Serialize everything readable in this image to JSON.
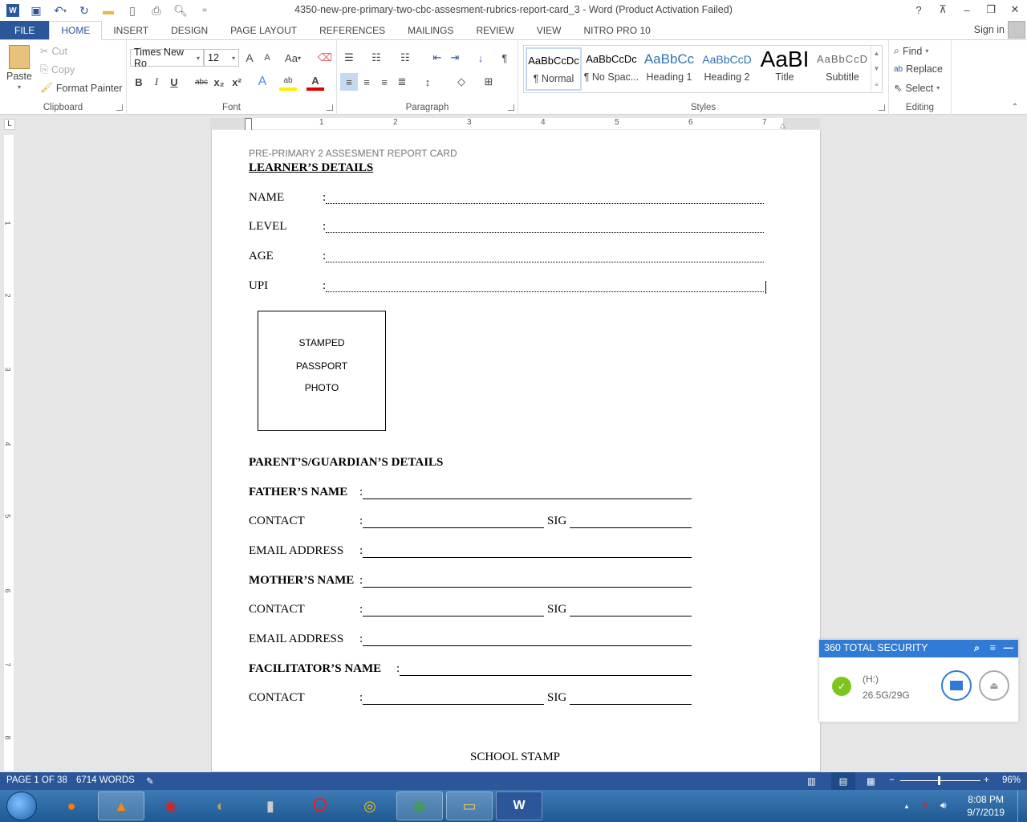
{
  "window": {
    "title": "4350-new-pre-primary-two-cbc-assesment-rubrics-report-card_3 - Word (Product Activation Failed)",
    "controls": {
      "help": "?",
      "ribbon_display": "⊼",
      "minimize": "–",
      "restore": "❐",
      "close": "✕"
    }
  },
  "qat": {
    "undo_icon": "↶",
    "redo_icon": "↻",
    "customize": "="
  },
  "tabs": [
    {
      "label": "FILE"
    },
    {
      "label": "HOME"
    },
    {
      "label": "INSERT"
    },
    {
      "label": "DESIGN"
    },
    {
      "label": "PAGE LAYOUT"
    },
    {
      "label": "REFERENCES"
    },
    {
      "label": "MAILINGS"
    },
    {
      "label": "REVIEW"
    },
    {
      "label": "VIEW"
    },
    {
      "label": "NITRO PRO 10"
    }
  ],
  "signin": "Sign in",
  "ribbon": {
    "clipboard": {
      "label": "Clipboard",
      "paste": "Paste",
      "cut": "Cut",
      "copy": "Copy",
      "format_painter": "Format Painter"
    },
    "font": {
      "label": "Font",
      "font_name": "Times New Ro",
      "font_size": "12",
      "bold": "B",
      "italic": "I",
      "underline": "U",
      "strike": "abc",
      "sub": "x₂",
      "sup": "x²",
      "change_case": "Aa",
      "grow": "A",
      "shrink": "A"
    },
    "paragraph": {
      "label": "Paragraph",
      "pilcrow": "¶"
    },
    "styles": {
      "label": "Styles",
      "items": [
        {
          "preview": "AaBbCcDc",
          "name": "¶ Normal"
        },
        {
          "preview": "AaBbCcDc",
          "name": "¶ No Spac..."
        },
        {
          "preview": "AaBbCc",
          "name": "Heading 1"
        },
        {
          "preview": "AaBbCcD",
          "name": "Heading 2"
        },
        {
          "preview": "AaBI",
          "name": "Title"
        },
        {
          "preview": "AaBbCcD",
          "name": "Subtitle"
        }
      ]
    },
    "editing": {
      "label": "Editing",
      "find": "Find",
      "replace": "Replace",
      "select": "Select"
    }
  },
  "ruler": {
    "numbers": [
      "1",
      "2",
      "3",
      "4",
      "5",
      "6",
      "7"
    ],
    "vnumbers": [
      "1",
      "2",
      "3",
      "4",
      "5",
      "6",
      "7",
      "8"
    ]
  },
  "document": {
    "header": "PRE-PRIMARY 2 ASSESMENT REPORT CARD",
    "learner_heading": "LEARNER’S DETAILS",
    "learner_fields": [
      {
        "label": "NAME"
      },
      {
        "label": "LEVEL"
      },
      {
        "label": "AGE"
      },
      {
        "label": "UPI"
      }
    ],
    "photo_box": [
      "STAMPED",
      "PASSPORT",
      "PHOTO"
    ],
    "parent_heading": "PARENT’S/GUARDIAN’S DETAILS",
    "father_name": "FATHER’S NAME",
    "contact": "CONTACT",
    "sig": "SIG",
    "email": "EMAIL ADDRESS",
    "mother_name": "MOTHER’S NAME",
    "facilitator_name": "FACILITATOR’S NAME",
    "school_stamp": "SCHOOL STAMP",
    "colon": ":"
  },
  "statusbar": {
    "page": "PAGE 1 OF 38",
    "words": "6714 WORDS",
    "zoom": "96%",
    "zoom_level_percent": 96
  },
  "security_popup": {
    "title": "360 TOTAL SECURITY",
    "drive": "(H:)",
    "usage": "26.5G/29G",
    "accent": "#2f7bd6"
  },
  "taskbar": {
    "time": "8:08 PM",
    "date": "9/7/2019"
  }
}
